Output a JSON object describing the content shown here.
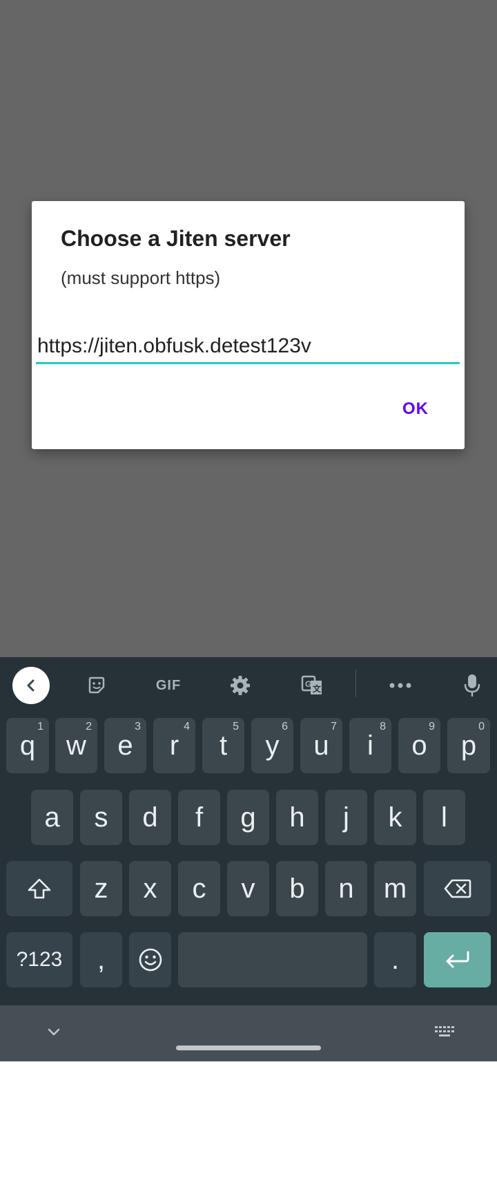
{
  "dialog": {
    "title": "Choose a Jiten server",
    "message": "(must support https)",
    "input_value": "https://jiten.obfusk.detest123v",
    "ok_label": "OK"
  },
  "keyboard": {
    "toolbar": {
      "icons": [
        "back-chevron-icon",
        "sticker-icon",
        "gif-icon",
        "gear-icon",
        "translate-icon",
        "more-icon",
        "mic-icon"
      ],
      "gif_label": "GIF"
    },
    "row1": [
      {
        "key": "q",
        "hint": "1"
      },
      {
        "key": "w",
        "hint": "2"
      },
      {
        "key": "e",
        "hint": "3"
      },
      {
        "key": "r",
        "hint": "4"
      },
      {
        "key": "t",
        "hint": "5"
      },
      {
        "key": "y",
        "hint": "6"
      },
      {
        "key": "u",
        "hint": "7"
      },
      {
        "key": "i",
        "hint": "8"
      },
      {
        "key": "o",
        "hint": "9"
      },
      {
        "key": "p",
        "hint": "0"
      }
    ],
    "row2": [
      "a",
      "s",
      "d",
      "f",
      "g",
      "h",
      "j",
      "k",
      "l"
    ],
    "row3": [
      "z",
      "x",
      "c",
      "v",
      "b",
      "n",
      "m"
    ],
    "symbols_label": "?123",
    "comma_label": ",",
    "period_label": ".",
    "accent_color": "#67ada4"
  },
  "colors": {
    "scrim": "#666666",
    "input_underline": "#22c9c4",
    "ok_text": "#6200ee",
    "keyboard_bg": "#263238"
  }
}
